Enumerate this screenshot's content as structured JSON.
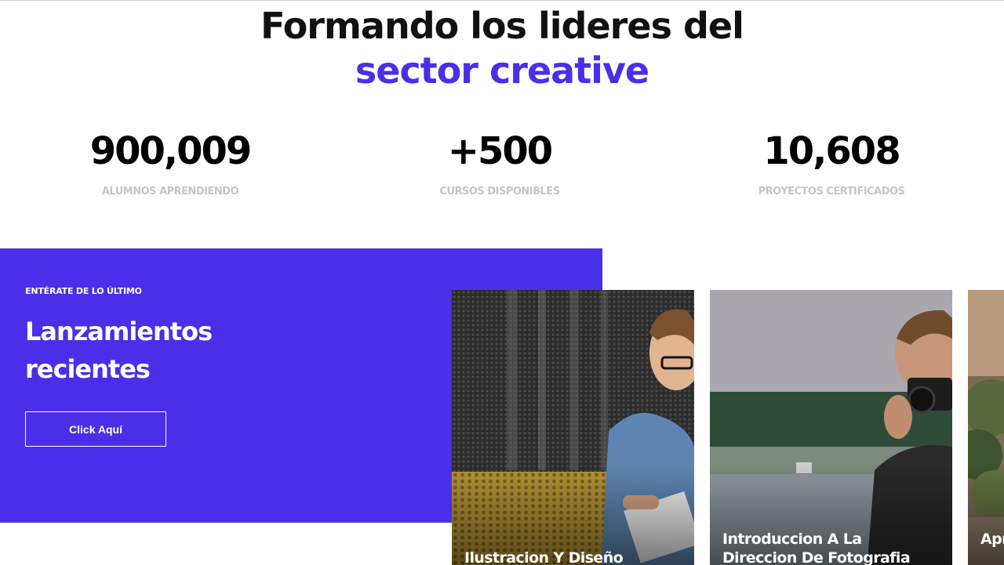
{
  "hero": {
    "line1": "Formando los lideres del",
    "line2": "sector creative",
    "accent_color": "#4a2fe8"
  },
  "stats": [
    {
      "value": "900,009",
      "label": "ALUMNOS APRENDIENDO"
    },
    {
      "value": "+500",
      "label": "CURSOS DISPONIBLES"
    },
    {
      "value": "10,608",
      "label": "PROYECTOS CERTIFICADOS"
    }
  ],
  "promo": {
    "kicker": "ENTÉRATE DE LO ÚLTIMO",
    "title": "Lanzamientos recientes",
    "button_label": "Click Aquí",
    "background_color": "#4a2fe8"
  },
  "courses": [
    {
      "title": "Ilustracion Y Diseño",
      "image": "man-writing-in-notebook-photo"
    },
    {
      "title": "Introduccion A La Direccion De Fotografia",
      "image": "man-with-camera-photo"
    },
    {
      "title": "Apr Inst",
      "image": "outdoor-greenery-photo"
    }
  ]
}
